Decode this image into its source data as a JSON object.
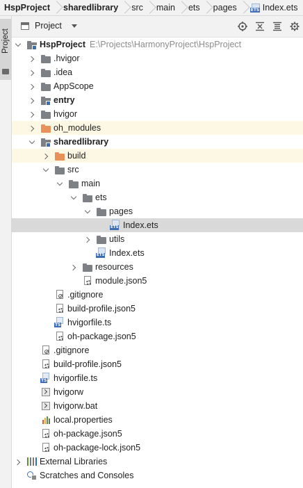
{
  "breadcrumb": [
    {
      "label": "HspProject",
      "bold": true
    },
    {
      "label": "sharedlibrary",
      "bold": true
    },
    {
      "label": "src",
      "bold": false
    },
    {
      "label": "main",
      "bold": false
    },
    {
      "label": "ets",
      "bold": false
    },
    {
      "label": "pages",
      "bold": false
    },
    {
      "label": "Index.ets",
      "bold": false,
      "icon": "ets-file-icon"
    }
  ],
  "side_strip": {
    "tab_label": "Project"
  },
  "panel": {
    "title": "Project",
    "tools": [
      "locate-target-icon",
      "collapse-all-icon",
      "expand-all-icon",
      "gear-icon"
    ]
  },
  "tree": [
    {
      "label": "HspProject",
      "bold": true,
      "path": "E:\\Projects\\HarmonyProject\\HspProject",
      "depth": 0,
      "arrow": "down",
      "icon": "folder-module-icon"
    },
    {
      "label": ".hvigor",
      "depth": 1,
      "arrow": "right",
      "icon": "folder-icon"
    },
    {
      "label": ".idea",
      "depth": 1,
      "arrow": "right",
      "icon": "folder-icon"
    },
    {
      "label": "AppScope",
      "depth": 1,
      "arrow": "right",
      "icon": "folder-icon"
    },
    {
      "label": "entry",
      "bold": true,
      "depth": 1,
      "arrow": "right",
      "icon": "folder-module-icon"
    },
    {
      "label": "hvigor",
      "depth": 1,
      "arrow": "right",
      "icon": "folder-icon"
    },
    {
      "label": "oh_modules",
      "depth": 1,
      "arrow": "right",
      "icon": "folder-orange-icon",
      "highlight": "yellow"
    },
    {
      "label": "sharedlibrary",
      "bold": true,
      "depth": 1,
      "arrow": "down",
      "icon": "folder-module-icon"
    },
    {
      "label": "build",
      "depth": 2,
      "arrow": "right",
      "icon": "folder-orange-icon",
      "highlight": "yellow"
    },
    {
      "label": "src",
      "depth": 2,
      "arrow": "down",
      "icon": "folder-icon"
    },
    {
      "label": "main",
      "depth": 3,
      "arrow": "down",
      "icon": "folder-icon"
    },
    {
      "label": "ets",
      "depth": 4,
      "arrow": "down",
      "icon": "folder-icon"
    },
    {
      "label": "pages",
      "depth": 5,
      "arrow": "down",
      "icon": "folder-icon"
    },
    {
      "label": "Index.ets",
      "depth": 6,
      "arrow": "none",
      "icon": "ets-file-icon",
      "highlight": "selected"
    },
    {
      "label": "utils",
      "depth": 5,
      "arrow": "right",
      "icon": "folder-icon"
    },
    {
      "label": "Index.ets",
      "depth": 5,
      "arrow": "none",
      "icon": "ets-file-icon"
    },
    {
      "label": "resources",
      "depth": 4,
      "arrow": "right",
      "icon": "folder-icon"
    },
    {
      "label": "module.json5",
      "depth": 4,
      "arrow": "none",
      "icon": "json5-file-icon"
    },
    {
      "label": ".gitignore",
      "depth": 2,
      "arrow": "none",
      "icon": "gitignore-file-icon"
    },
    {
      "label": "build-profile.json5",
      "depth": 2,
      "arrow": "none",
      "icon": "json5-file-icon"
    },
    {
      "label": "hvigorfile.ts",
      "depth": 2,
      "arrow": "none",
      "icon": "ts-file-icon"
    },
    {
      "label": "oh-package.json5",
      "depth": 2,
      "arrow": "none",
      "icon": "settings-file-icon"
    },
    {
      "label": ".gitignore",
      "depth": 1,
      "arrow": "none",
      "icon": "gitignore-file-icon"
    },
    {
      "label": "build-profile.json5",
      "depth": 1,
      "arrow": "none",
      "icon": "json5-file-icon"
    },
    {
      "label": "hvigorfile.ts",
      "depth": 1,
      "arrow": "none",
      "icon": "ts-file-icon"
    },
    {
      "label": "hvigorw",
      "depth": 1,
      "arrow": "none",
      "icon": "terminal-file-icon"
    },
    {
      "label": "hvigorw.bat",
      "depth": 1,
      "arrow": "none",
      "icon": "terminal-file-icon"
    },
    {
      "label": "local.properties",
      "depth": 1,
      "arrow": "none",
      "icon": "properties-file-icon"
    },
    {
      "label": "oh-package.json5",
      "depth": 1,
      "arrow": "none",
      "icon": "settings-file-icon"
    },
    {
      "label": "oh-package-lock.json5",
      "depth": 1,
      "arrow": "none",
      "icon": "settings-file-icon"
    },
    {
      "label": "External Libraries",
      "depth": 0,
      "arrow": "right",
      "icon": "external-libraries-icon"
    },
    {
      "label": "Scratches and Consoles",
      "depth": 0,
      "arrow": "none",
      "icon": "scratches-icon"
    }
  ]
}
